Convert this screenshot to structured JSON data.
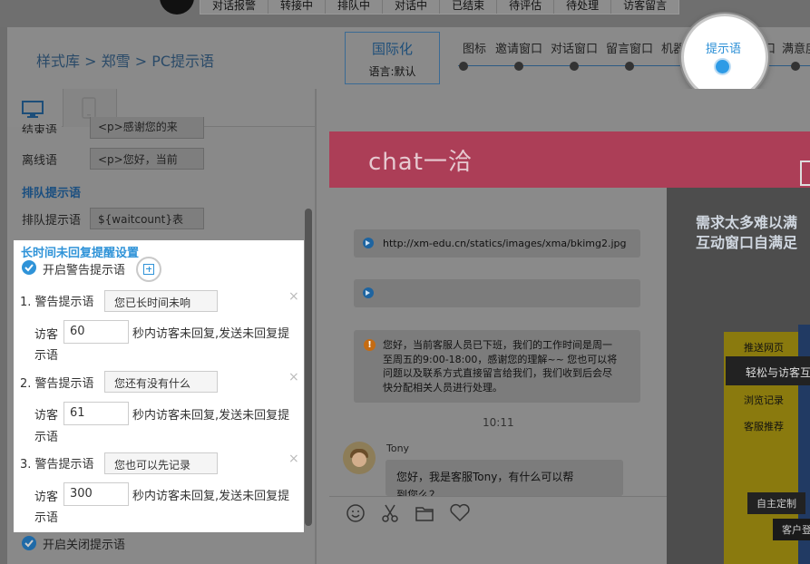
{
  "top_tabs": [
    "对话报警",
    "转接中",
    "排队中",
    "对话中",
    "已结束",
    "待评估",
    "待处理",
    "访客留言"
  ],
  "breadcrumb": {
    "item1": "样式库",
    "sep": ">",
    "item2": "郑雪",
    "item3": "PC提示语"
  },
  "i18n": {
    "title": "国际化",
    "subtitle": "语言:默认"
  },
  "steps": [
    "图标",
    "邀请窗口",
    "对话窗口",
    "留言窗口",
    "机器人",
    "提示语",
    "入口",
    "满意度"
  ],
  "active_step": "提示语",
  "settings": {
    "end_label": "结束语",
    "end_value": "<p>感谢您的来",
    "offline_label": "离线语",
    "offline_value": "<p>您好，当前",
    "queue_section": "排队提示语",
    "queue_label": "排队提示语",
    "queue_value": "${waitcount}表",
    "long_section": "长时间未回复提醒设置",
    "enable_warning": "开启警告提示语",
    "warnings": [
      {
        "label": "1. 警告提示语",
        "value": "您已长时间未响",
        "visitor": "访客",
        "seconds": "60",
        "desc1": "秒内访客未回复,发送未回复提",
        "desc2": "示语"
      },
      {
        "label": "2. 警告提示语",
        "value": "您还有没有什么",
        "visitor": "访客",
        "seconds": "61",
        "desc1": "秒内访客未回复,发送未回复提",
        "desc2": "示语"
      },
      {
        "label": "3. 警告提示语",
        "value": "您也可以先记录",
        "visitor": "访客",
        "seconds": "300",
        "desc1": "秒内访客未回复,发送未回复提",
        "desc2": "示语"
      }
    ],
    "enable_close": "开启关闭提示语",
    "close_mark": "×"
  },
  "preview": {
    "brand": "chat一洽",
    "audio_url": "http://xm-edu.cn/statics/images/xma/bkimg2.jpg",
    "offline_notice": "您好，当前客服人员已下班，我们的工作时间是周一至周五的9:00-18:00，感谢您的理解~~ 您也可以将问题以及联系方式直接留言给我们，我们收到后会尽快分配相关人员进行处理。",
    "offline_lines": [
      "您好，当前客服人员已下班，我们的工作时间是周一",
      "至周五的9:00-18:00，感谢您的理解~~ 您也可以将",
      "问题以及联系方式直接留言给我们，我们收到后会尽",
      "快分配相关人员进行处理。"
    ],
    "time": "10:11",
    "agent": "Tony",
    "agent_msg_1": "您好，我是客服Tony，有什么可以帮",
    "agent_msg_2": "到您么？"
  },
  "ad": {
    "title1": "需求太多难以满",
    "title2": "互动窗口自满足",
    "menu": [
      "推送网页",
      "浏览记录",
      "客服推荐"
    ],
    "active": "轻松与访客互",
    "btn1": "自主定制",
    "btn2": "客户登"
  }
}
